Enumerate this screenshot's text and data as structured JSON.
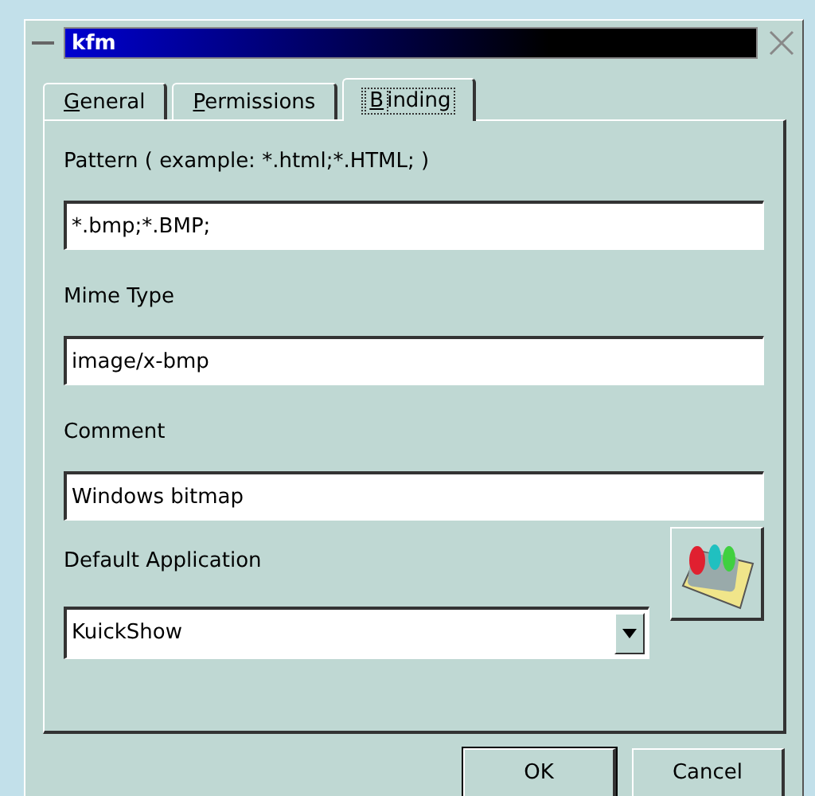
{
  "window": {
    "title": "kfm"
  },
  "tabs": [
    {
      "label": "General",
      "selected": false
    },
    {
      "label": "Permissions",
      "selected": false
    },
    {
      "label": "Binding",
      "selected": true
    }
  ],
  "fields": [
    {
      "label": "Pattern ( example: *.html;*.HTML; )",
      "value": "*.bmp;*.BMP;"
    },
    {
      "label": "Mime Type",
      "value": "image/x-bmp"
    },
    {
      "label": "Comment",
      "value": "Windows bitmap"
    }
  ],
  "default_application": {
    "label": "Default Application",
    "value": "KuickShow"
  },
  "buttons": [
    "OK",
    "Cancel"
  ]
}
